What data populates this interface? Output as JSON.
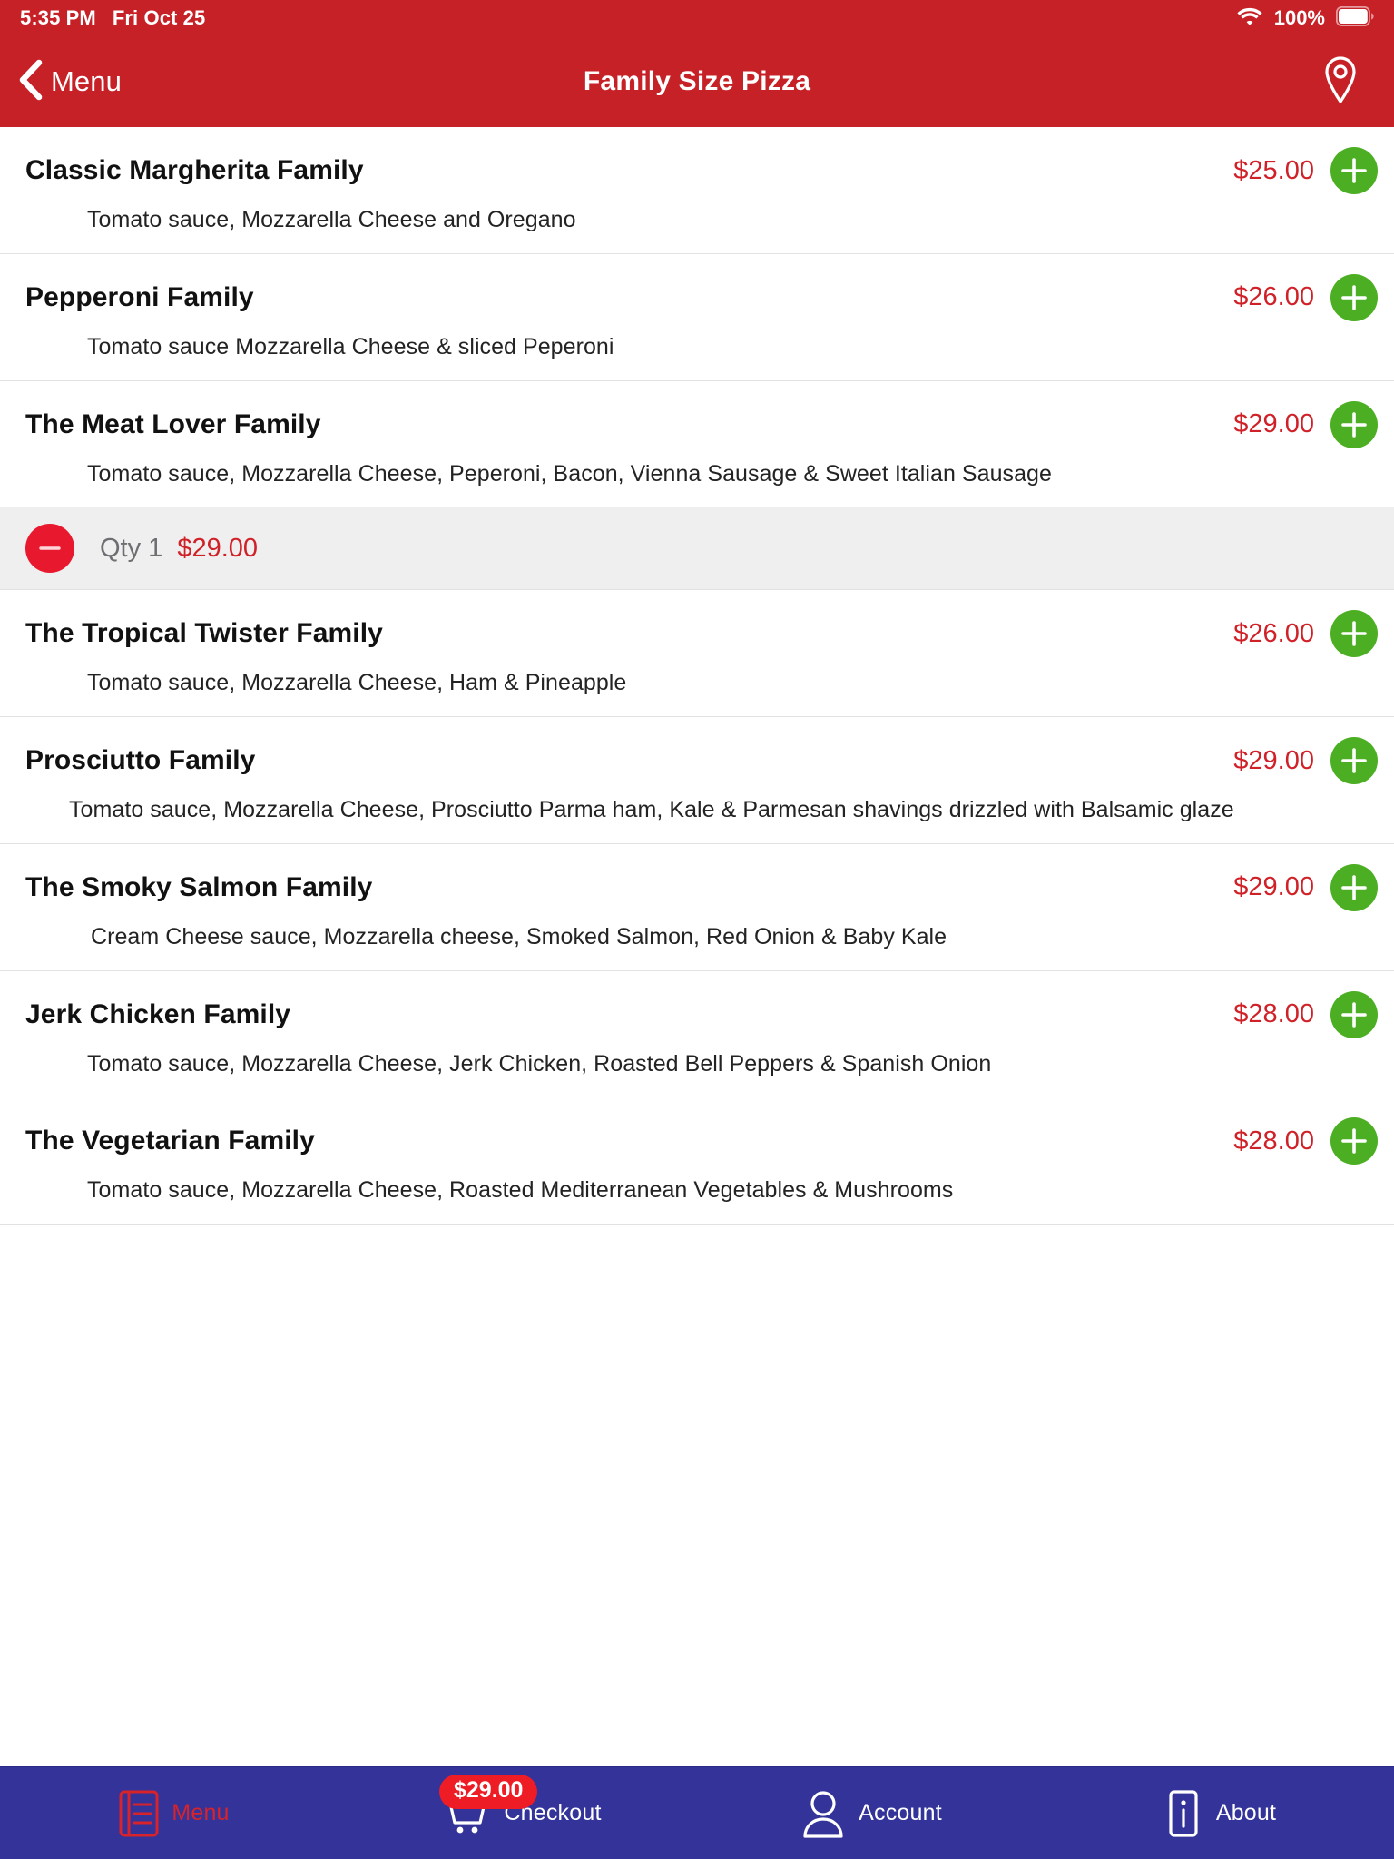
{
  "status_bar": {
    "time": "5:35 PM",
    "date": "Fri Oct 25",
    "battery_percent": "100%",
    "wifi_icon": "wifi-icon",
    "battery_icon": "battery-icon"
  },
  "nav": {
    "back_label": "Menu",
    "back_icon": "chevron-left-icon",
    "title": "Family Size Pizza",
    "right_icon": "location-pin-icon"
  },
  "colors": {
    "header_red": "#C62127",
    "price_red": "#D02128",
    "add_green": "#4CAF23",
    "minus_red": "#E8192F",
    "tab_bar_indigo": "#33339A",
    "badge_red": "#EE1C25",
    "qty_row_gray": "#EFEFEF"
  },
  "menu_items": [
    {
      "name": "Classic Margherita Family",
      "price": "$25.00",
      "description": "Tomato sauce, Mozzarella Cheese and Oregano",
      "add_label": "+"
    },
    {
      "name": "Pepperoni Family",
      "price": "$26.00",
      "description": "Tomato sauce Mozzarella Cheese & sliced Peperoni",
      "add_label": "+"
    },
    {
      "name": "The Meat Lover Family",
      "price": "$29.00",
      "description": "Tomato sauce, Mozzarella Cheese, Peperoni, Bacon, Vienna Sausage & Sweet Italian Sausage",
      "add_label": "+",
      "qty_row": {
        "qty_label": "Qty 1",
        "qty_price": "$29.00",
        "minus_label": "−"
      }
    },
    {
      "name": "The Tropical Twister Family",
      "price": "$26.00",
      "description": "Tomato sauce, Mozzarella Cheese, Ham & Pineapple",
      "add_label": "+"
    },
    {
      "name": "Prosciutto Family",
      "price": "$29.00",
      "description": "Tomato sauce, Mozzarella Cheese, Prosciutto Parma ham, Kale & Parmesan shavings drizzled with Balsamic glaze",
      "add_label": "+"
    },
    {
      "name": "The Smoky Salmon Family",
      "price": "$29.00",
      "description": "Cream Cheese sauce, Mozzarella cheese, Smoked Salmon, Red Onion & Baby Kale",
      "add_label": "+"
    },
    {
      "name": "Jerk Chicken Family",
      "price": "$28.00",
      "description": "Tomato sauce, Mozzarella Cheese, Jerk Chicken, Roasted Bell Peppers & Spanish Onion",
      "add_label": "+"
    },
    {
      "name": "The Vegetarian Family",
      "price": "$28.00",
      "description": "Tomato sauce, Mozzarella Cheese, Roasted Mediterranean Vegetables & Mushrooms",
      "add_label": "+"
    }
  ],
  "tab_bar": {
    "tabs": [
      {
        "label": "Menu",
        "icon": "menu-book-icon",
        "active": true
      },
      {
        "label": "Checkout",
        "icon": "shopping-cart-icon",
        "badge": "$29.00",
        "active": false
      },
      {
        "label": "Account",
        "icon": "person-icon",
        "active": false
      },
      {
        "label": "About",
        "icon": "info-icon",
        "active": false
      }
    ]
  }
}
